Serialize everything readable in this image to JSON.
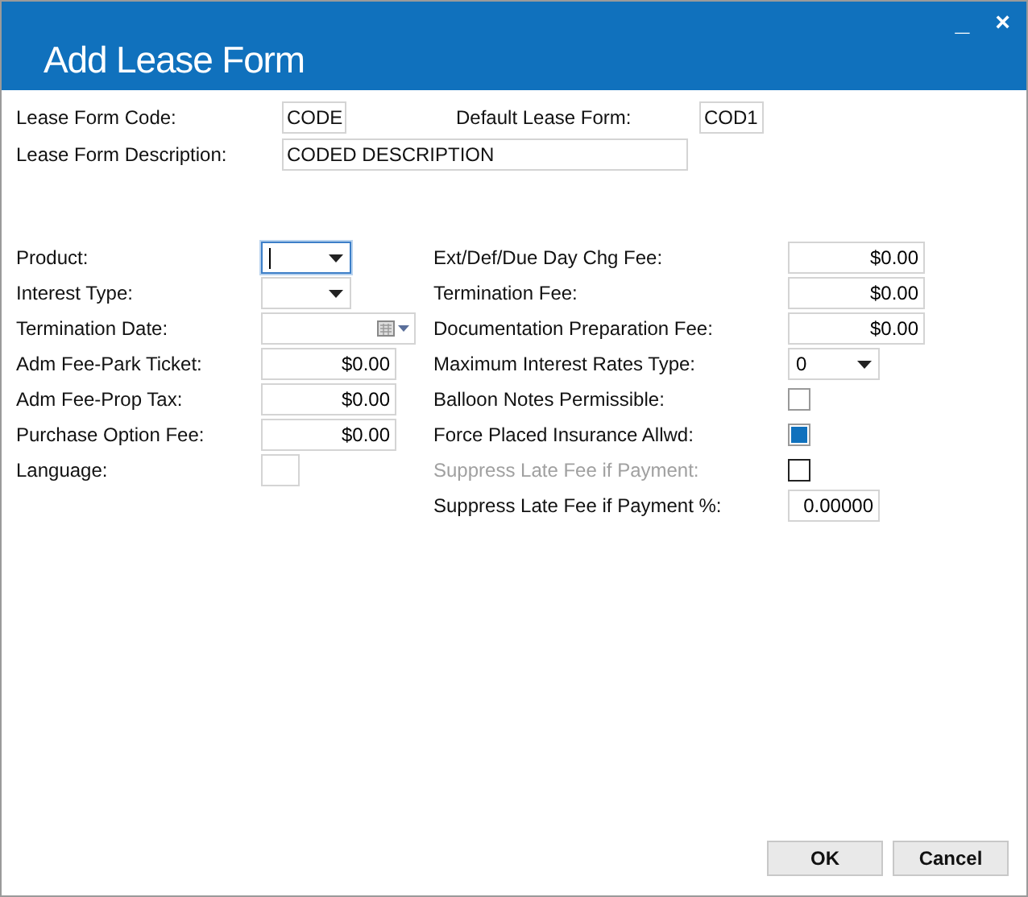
{
  "window": {
    "title": "Add Lease Form",
    "controls": [
      "_",
      "×"
    ]
  },
  "header_fields": [
    {
      "label": "Lease Form Code:",
      "value": "CODE"
    },
    {
      "label": "Default Lease Form:",
      "value": "COD1"
    },
    {
      "label": "Lease Form Description:",
      "value": "CODED DESCRIPTION"
    }
  ],
  "left_fields": [
    {
      "label": "Product:",
      "kind": "select",
      "focused": true
    },
    {
      "label": "Interest Type:",
      "kind": "select",
      "focused": false
    },
    {
      "label": "Termination Date:",
      "kind": "date"
    },
    {
      "label": "Adm Fee-Park Ticket:",
      "kind": "money",
      "value": "$0.00"
    },
    {
      "label": "Adm Fee-Prop Tax:",
      "kind": "money",
      "value": "$0.00"
    },
    {
      "label": "Purchase Option Fee:",
      "kind": "money",
      "value": "$0.00"
    },
    {
      "label": "Language:",
      "kind": "text"
    }
  ],
  "right_fields": [
    {
      "label": "Ext/Def/Due Day Chg Fee:",
      "kind": "money",
      "value": "$0.00"
    },
    {
      "label": "Termination Fee:",
      "kind": "money",
      "value": "$0.00"
    },
    {
      "label": "Documentation Preparation Fee:",
      "kind": "money",
      "value": "$0.00"
    },
    {
      "label": "Maximum Interest Rates Type:",
      "kind": "select",
      "value": "0"
    },
    {
      "label": "Balloon Notes Permissible:",
      "kind": "checkbox",
      "checked": false,
      "disabled": false
    },
    {
      "label": "Force Placed Insurance Allwd:",
      "kind": "checkbox",
      "checked": true,
      "disabled": false
    },
    {
      "label": "Suppress Late Fee if Payment:",
      "kind": "checkbox",
      "checked": false,
      "disabled": true
    },
    {
      "label": "Suppress Late Fee if Payment %:",
      "kind": "number",
      "value": "0.00000"
    }
  ],
  "buttons": [
    "OK",
    "Cancel"
  ]
}
